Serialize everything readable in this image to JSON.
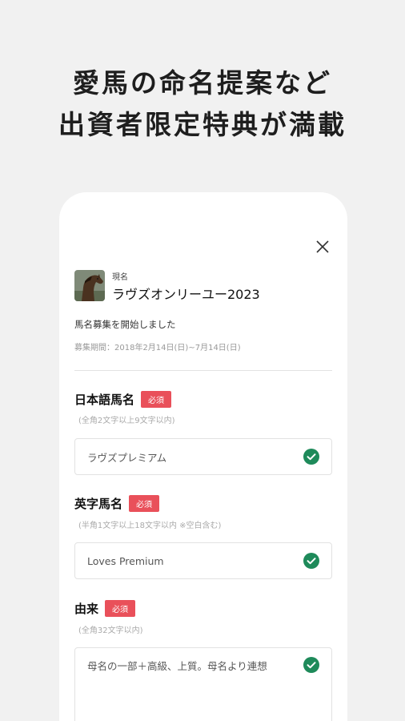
{
  "headline": {
    "line1": "愛馬の命名提案など",
    "line2": "出資者限定特典が満載"
  },
  "horse": {
    "status": "現名",
    "name": "ラヴズオンリーユー2023"
  },
  "notice": "馬名募集を開始しました",
  "period": "募集期間：2018年2月14日(日)~7月14日(日)",
  "fields": [
    {
      "label": "日本語馬名",
      "badge": "必須",
      "hint": "(全角2文字以上9文字以内)",
      "value": "ラヴズプレミアム"
    },
    {
      "label": "英字馬名",
      "badge": "必須",
      "hint": "(半角1文字以上18文字以内 ※空白含む)",
      "value": "Loves Premium"
    },
    {
      "label": "由来",
      "badge": "必須",
      "hint": "(全角32文字以内)",
      "value": "母名の一部＋高級、上質。母名より連想"
    }
  ],
  "colors": {
    "accent": "#1e8a5a",
    "badge": "#e9505a",
    "background": "#f1f1f1"
  },
  "icons": {
    "close": "close-icon",
    "check": "check-circle-icon"
  }
}
